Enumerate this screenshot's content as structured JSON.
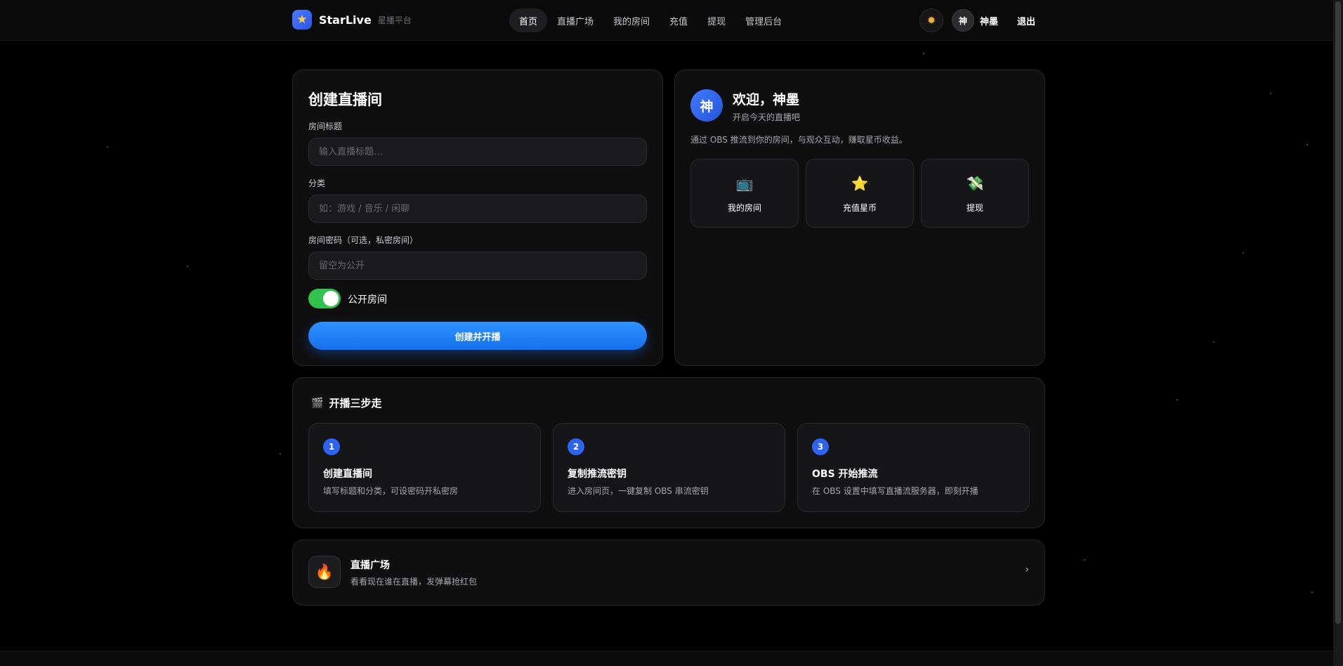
{
  "brand": {
    "name": "StarLive",
    "subtitle": "星播平台",
    "logo_icon": "star-icon"
  },
  "nav": {
    "items": [
      {
        "label": "首页",
        "active": true
      },
      {
        "label": "直播广场",
        "active": false
      },
      {
        "label": "我的房间",
        "active": false
      },
      {
        "label": "充值",
        "active": false
      },
      {
        "label": "提现",
        "active": false
      },
      {
        "label": "管理后台",
        "active": false
      }
    ]
  },
  "user": {
    "avatar_initial": "神",
    "name": "神墨",
    "logout_label": "退出",
    "theme_icon": "sun-icon"
  },
  "create_room": {
    "title": "创建直播间",
    "title_label": "房间标题",
    "title_placeholder": "输入直播标题…",
    "category_label": "分类",
    "category_placeholder": "如：游戏 / 音乐 / 闲聊",
    "password_label": "房间密码（可选，私密房间）",
    "password_placeholder": "留空为公开",
    "public_toggle_label": "公开房间",
    "public_toggle_on": true,
    "submit_label": "创建并开播"
  },
  "welcome": {
    "avatar_initial": "神",
    "title": "欢迎，神墨",
    "subtitle": "开启今天的直播吧",
    "description": "通过 OBS 推流到你的房间，与观众互动，赚取星币收益。",
    "quick_actions": [
      {
        "icon": "tv-icon",
        "glyph": "📺",
        "label": "我的房间"
      },
      {
        "icon": "star-icon",
        "glyph": "⭐",
        "label": "充值星币"
      },
      {
        "icon": "money-wings-icon",
        "glyph": "💸",
        "label": "提现"
      }
    ]
  },
  "steps": {
    "icon": "clapper-icon",
    "title": "开播三步走",
    "items": [
      {
        "num": "1",
        "title": "创建直播间",
        "desc": "填写标题和分类，可设密码开私密房"
      },
      {
        "num": "2",
        "title": "复制推流密钥",
        "desc": "进入房间页，一键复制 OBS 串流密钥"
      },
      {
        "num": "3",
        "title": "OBS 开始推流",
        "desc": "在 OBS 设置中填写直播流服务器，即刻开播"
      }
    ]
  },
  "plaza": {
    "icon": "fire-icon",
    "title": "直播广场",
    "description": "看看现在谁在直播，发弹幕抢红包",
    "chevron": "›"
  },
  "colors": {
    "accent": "#1670ee",
    "toggle_on": "#30c24c",
    "step_badge": "#2e63f0",
    "background": "#000000"
  }
}
